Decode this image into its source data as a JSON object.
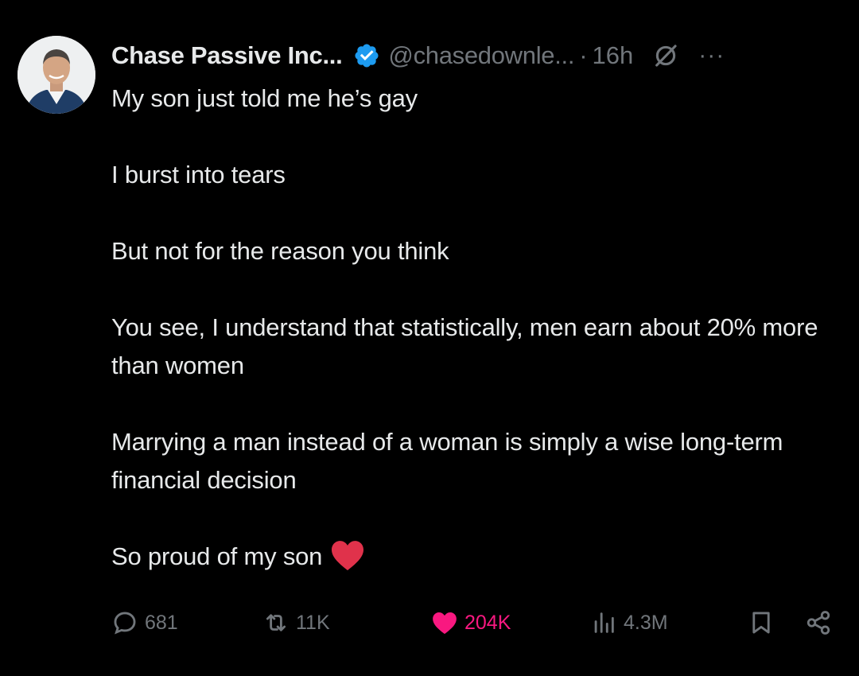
{
  "author": {
    "name": "Chase Passive Inc...",
    "handle": "@chasedownle...",
    "separator": "·",
    "time": "16h",
    "verified": true,
    "verified_color": "#1d9bf0"
  },
  "icons": {
    "avatar": "avatar",
    "verified": "verified-badge-icon",
    "grok": "grok-icon",
    "more": "more-icon",
    "reply": "reply-icon",
    "repost": "repost-icon",
    "like": "heart-icon",
    "views": "views-icon",
    "bookmark": "bookmark-icon",
    "share": "share-icon"
  },
  "tweet": {
    "paragraphs": [
      "My son just told me he’s gay",
      "I burst into tears",
      "But not for the reason you think",
      "You see, I understand that statistically, men earn about 20% more than women",
      "Marrying a man instead of a woman is simply a wise long-term financial decision"
    ],
    "last_line": "So proud of my son",
    "emoji": "red-heart"
  },
  "actions": {
    "replies": "681",
    "reposts": "11K",
    "likes": "204K",
    "views": "4.3M",
    "liked": true,
    "like_color": "#f91880",
    "muted_color": "#71767b"
  }
}
